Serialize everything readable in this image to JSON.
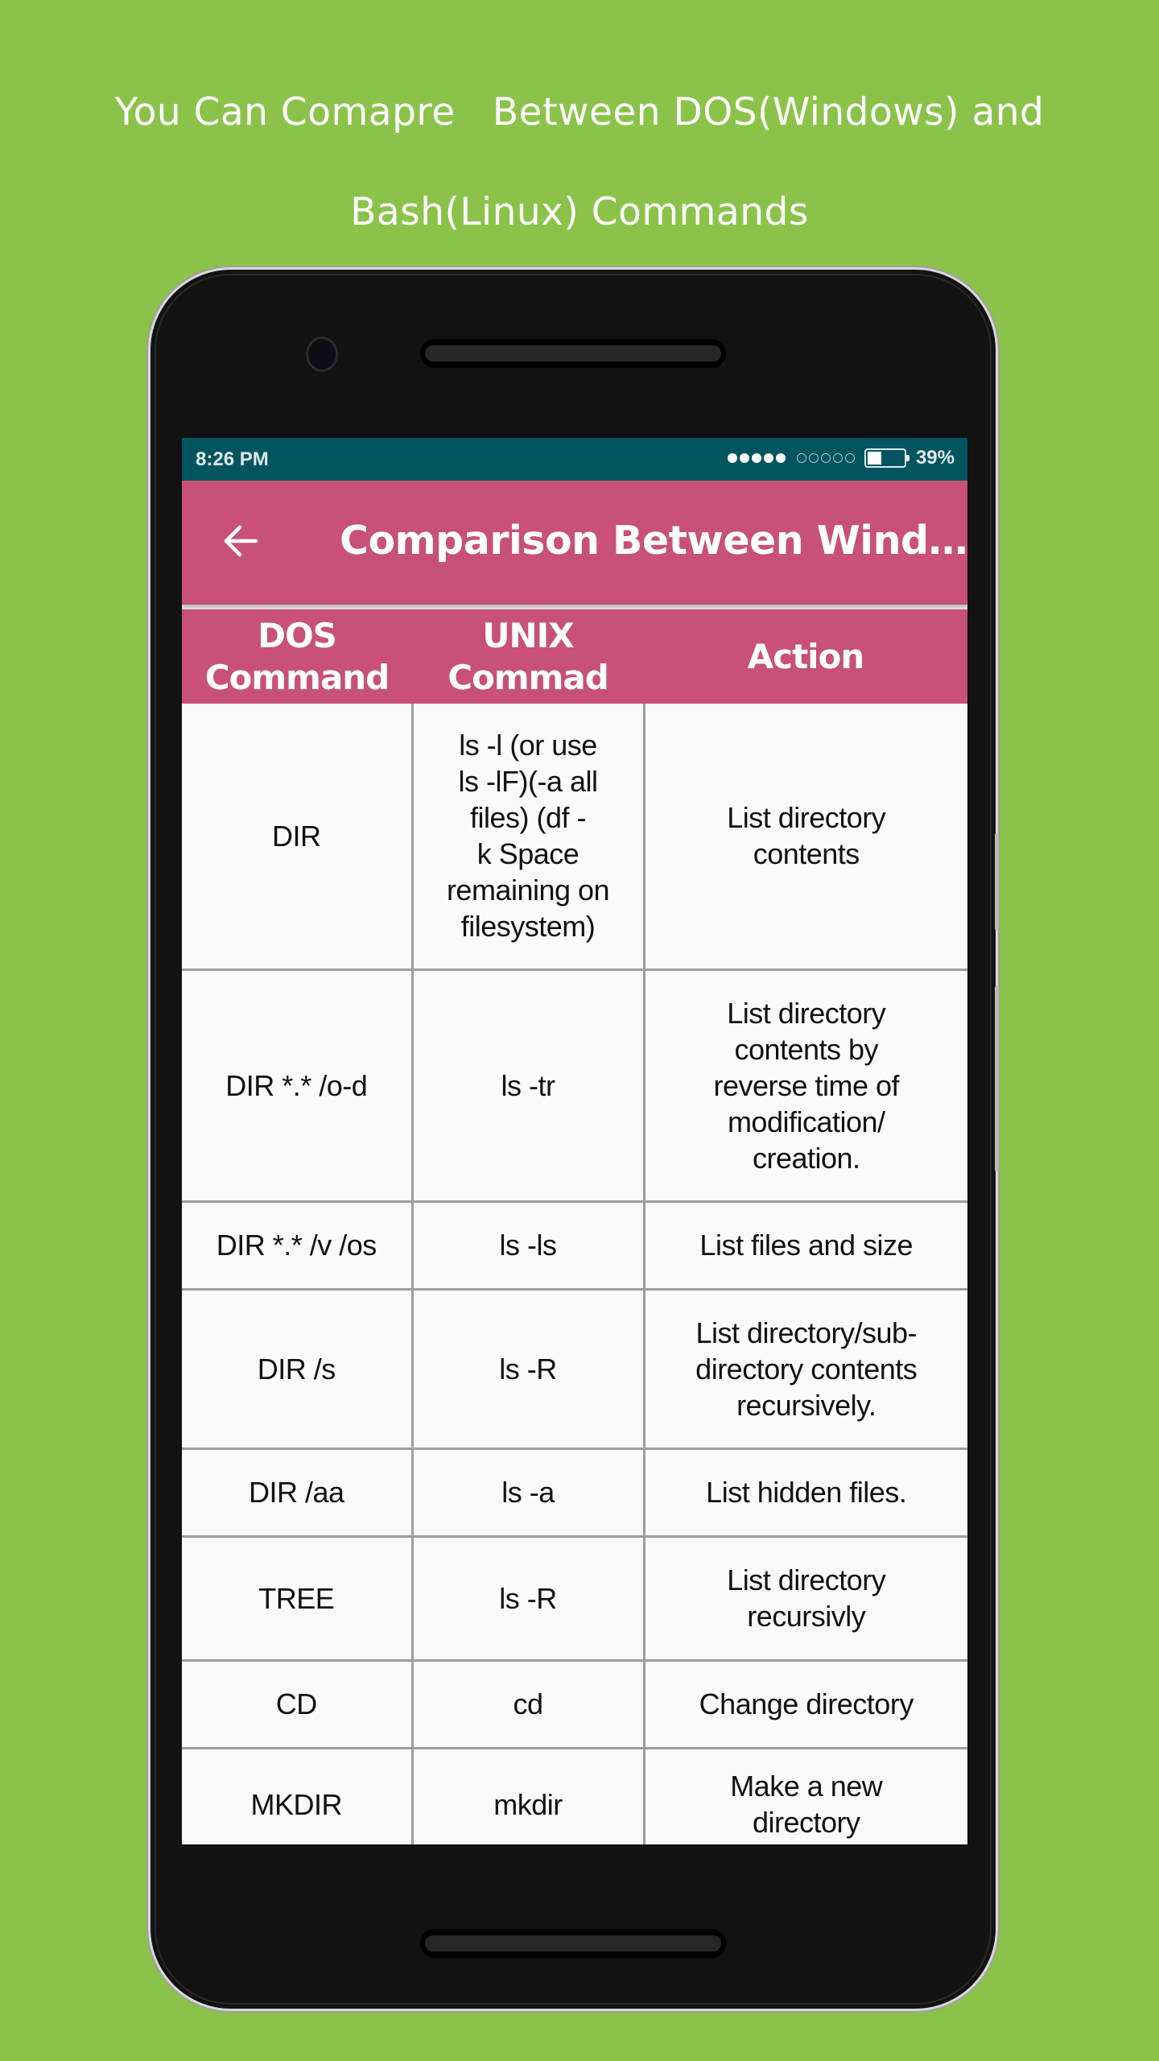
{
  "promo": {
    "line1": "You Can Comapre   Between DOS(Windows) and",
    "line2": "Bash(Linux) Commands"
  },
  "status_bar": {
    "time": "8:26 PM",
    "signal_filled": 5,
    "signal_empty": 5,
    "battery_percent": 39,
    "battery_label": "39%"
  },
  "app_bar": {
    "back_icon": "arrow-back-icon",
    "title": "Comparison Between Wind…"
  },
  "colors": {
    "background": "#8bc34a",
    "status_bar": "#02555f",
    "accent": "#c85079"
  },
  "table": {
    "headers": [
      "DOS\nCommand",
      "UNIX\nCommad",
      "Action"
    ],
    "rows": [
      {
        "dos": "DIR",
        "unix": "ls -l (or use\nls -lF)(-a all\nfiles) (df -\nk Space\nremaining on\nfilesystem)",
        "action": "List directory\ncontents"
      },
      {
        "dos": "DIR *.* /o-d",
        "unix": "ls -tr",
        "action": "List directory\ncontents by\nreverse time of\nmodification/\ncreation."
      },
      {
        "dos": "DIR *.* /v /os",
        "unix": "ls -ls",
        "action": "List files and size"
      },
      {
        "dos": "DIR /s",
        "unix": "ls -R",
        "action": "List directory/sub-\ndirectory contents\nrecursively."
      },
      {
        "dos": "DIR /aa",
        "unix": "ls -a",
        "action": "List hidden files."
      },
      {
        "dos": "TREE",
        "unix": "ls -R",
        "action": "List directory\nrecursivly"
      },
      {
        "dos": "CD",
        "unix": "cd",
        "action": "Change directory"
      },
      {
        "dos": "MKDIR",
        "unix": "mkdir",
        "action": "Make a new\ndirectory"
      }
    ]
  }
}
